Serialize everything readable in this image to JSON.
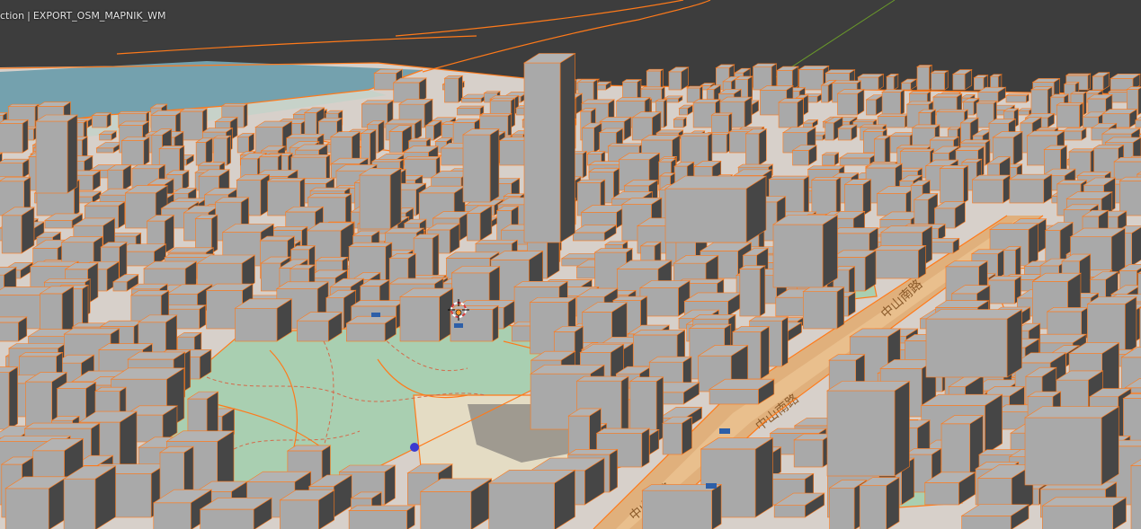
{
  "viewport": {
    "view_label": "ction",
    "separator": "|",
    "object_name": "EXPORT_OSM_MAPNIK_WM"
  },
  "map_labels": {
    "road_1": "中山南路",
    "road_2": "中山南路",
    "road_3": "中山南路"
  },
  "colors": {
    "viewport_background": "#3d3d3d",
    "building_top": "#a9a9a9",
    "building_side_light": "#8a8a8a",
    "building_side_dark": "#464646",
    "selection_outline": "#ff7a1a",
    "map_base": "#d9d2cc",
    "park_green": "#a9cfb1",
    "water": "#6d9aa8",
    "road": "#e2a86a",
    "axis_green": "#6a9a2a",
    "origin_marker": "#ffffff"
  },
  "icons": {
    "origin": "object-origin-icon",
    "cursor": "3d-cursor-icon"
  }
}
